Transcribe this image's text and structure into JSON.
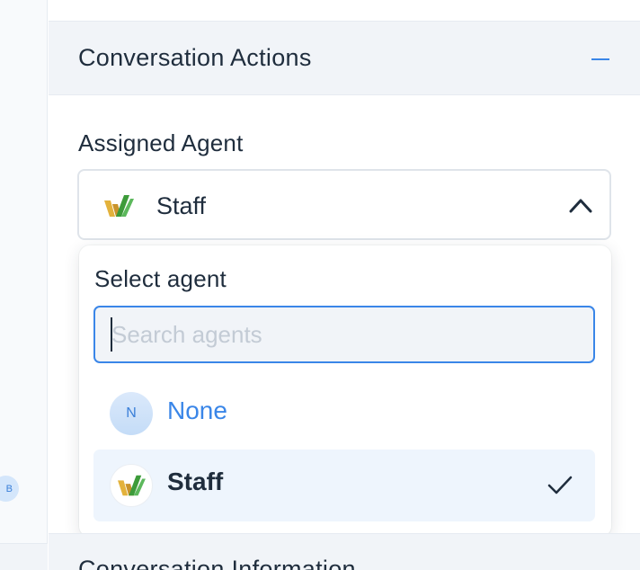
{
  "sidebar": {
    "avatar_initial": "B"
  },
  "section": {
    "title": "Conversation Actions",
    "collapse_icon": "minus-icon"
  },
  "assigned_agent": {
    "label": "Assigned Agent",
    "selected_value": "Staff",
    "logo_icon": "staff-logo-icon",
    "chevron_icon": "chevron-up-icon"
  },
  "dropdown": {
    "title": "Select agent",
    "search": {
      "placeholder": "Search agents",
      "value": ""
    },
    "options": [
      {
        "initial": "N",
        "label": "None",
        "selected": false
      },
      {
        "label": "Staff",
        "selected": true,
        "icon": "check-icon"
      }
    ]
  },
  "next_section": {
    "title": "Conversation Information"
  },
  "colors": {
    "accent": "#3a86e8",
    "text": "#1f2d3d",
    "header_bg": "#f1f4f8",
    "selected_bg": "#eef5fd",
    "logo_gold": "#e3b23c",
    "logo_green": "#3d9b3a"
  }
}
